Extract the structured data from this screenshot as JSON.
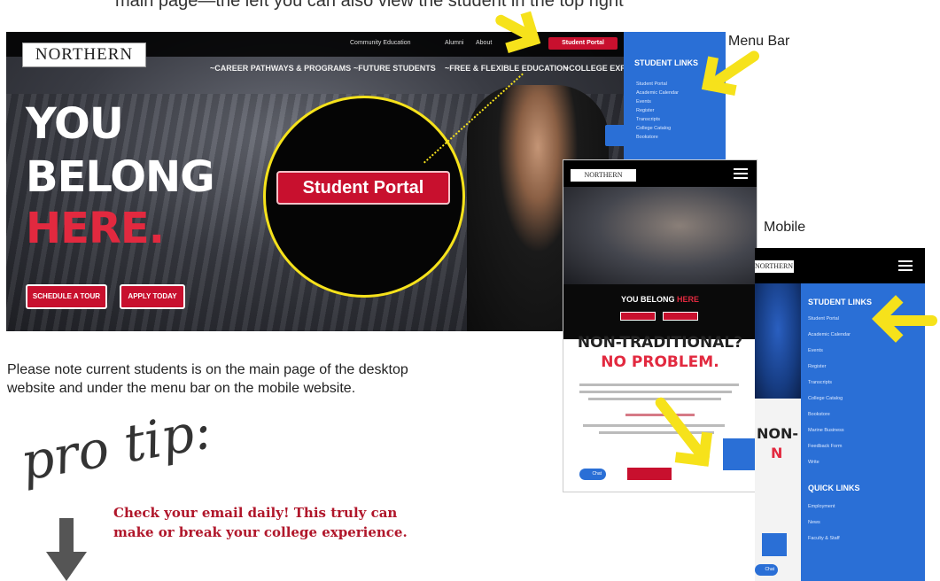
{
  "caption_top": "main page—the left you can also view the student in the top right ",
  "desktop": {
    "logo": "NORTHERN",
    "util_links": [
      "Community Education",
      "Alumni",
      "About"
    ],
    "student_portal": "Student Portal",
    "nav": [
      "~CAREER PATHWAYS & PROGRAMS",
      "~FUTURE STUDENTS",
      "~FREE & FLEXIBLE EDUCATION",
      "~COLLEGE EXPE"
    ],
    "hero": [
      "YOU",
      "BELONG",
      "HERE."
    ],
    "ctas": [
      "SCHEDULE A TOUR",
      "APPLY TODAY"
    ]
  },
  "menu_panel": {
    "title": "STUDENT LINKS",
    "items": [
      "Student Portal",
      "Academic Calendar",
      "Events",
      "Register",
      "Transcripts",
      "College Catalog",
      "Bookstore"
    ]
  },
  "zoom_button": "Student Portal",
  "labels": {
    "menu_bar": "Menu Bar",
    "mobile": "Mobile"
  },
  "mobile1": {
    "logo": "NORTHERN",
    "headline_white": "YOU BELONG",
    "headline_red": "HERE",
    "ntrad_line1": "NON-TRADITIONAL?",
    "ntrad_line2": "NO PROBLEM.",
    "chat": "Chat"
  },
  "mobile2": {
    "logo": "NORTHERN",
    "student_links_title": "STUDENT LINKS",
    "student_links": [
      "Student Portal",
      "Academic Calendar",
      "Events",
      "Register",
      "Transcripts",
      "College Catalog",
      "Bookstore",
      "Marine Business",
      "Feedback Form",
      "Write"
    ],
    "quick_links_title": "QUICK LINKS",
    "quick_links": [
      "Employment",
      "News",
      "Faculty & Staff"
    ],
    "non": "NON-",
    "n": "N",
    "chat": "Chat"
  },
  "note": "Please note current students is on the main page of the desktop website and under the menu bar on the mobile website.",
  "pro_tip": "pro tip:",
  "tip_text": "Check your email daily! This truly can make or break your college experience.",
  "colors": {
    "brand_red": "#c8102e",
    "menu_blue": "#2a6fd6",
    "highlight_yellow": "#f6e21b"
  }
}
